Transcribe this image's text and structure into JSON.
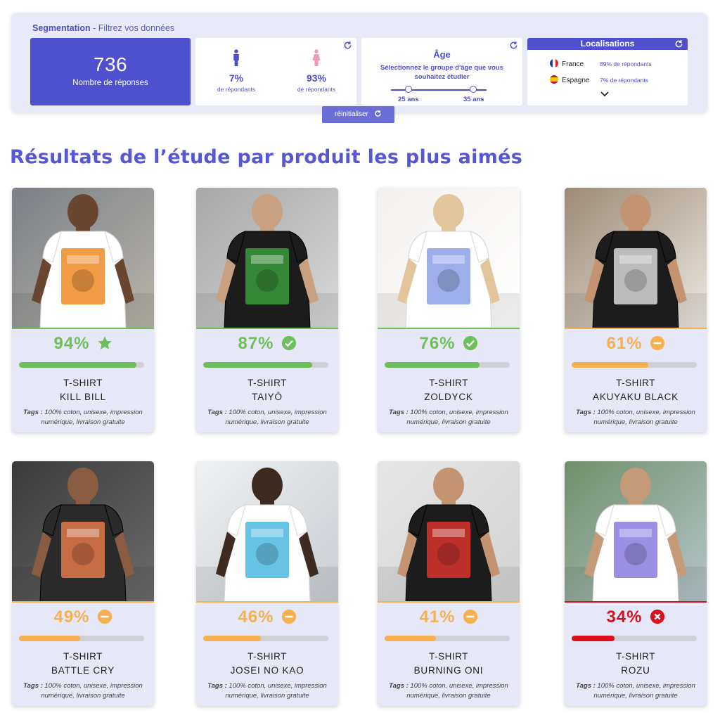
{
  "segmentation": {
    "title": "Segmentation",
    "subtitle": " - Filtrez vos données",
    "responses": {
      "count": "736",
      "label": "Nombre de réponses"
    },
    "gender": {
      "male": {
        "pct": "7%",
        "sub": "de répondants",
        "color": "#4f50cf"
      },
      "female": {
        "pct": "93%",
        "sub": "de répondants",
        "color": "#f29bb4"
      }
    },
    "age": {
      "title": "Âge",
      "description": "Sélectionnez le groupe d'âge que vous souhaitez étudier",
      "min_label": "25 ans",
      "max_label": "35 ans"
    },
    "locations": {
      "title": "Localisations",
      "items": [
        {
          "country": "France",
          "stat": "89% de répondants"
        },
        {
          "country": "Espagne",
          "stat": "7% de répondants"
        }
      ]
    },
    "reset_label": "réinitialiser"
  },
  "page_title": "Résultats de l’étude par produit les plus aimés",
  "colors": {
    "accent": "#4f50cf",
    "green": "#6ebf5a",
    "orange": "#f7b04f",
    "red": "#d9101c"
  },
  "tags_label": "Tags :",
  "tags_text": " 100% coton, unisexe,  impression numérique, livraison gratuite",
  "products": [
    {
      "score": "94%",
      "fraction": 0.94,
      "status": "star-icon",
      "type": "T-SHIRT",
      "name": "KILL BILL"
    },
    {
      "score": "87%",
      "fraction": 0.87,
      "status": "check-icon",
      "type": "T-SHIRT",
      "name": "TAIYŌ"
    },
    {
      "score": "76%",
      "fraction": 0.76,
      "status": "check-icon",
      "type": "T-SHIRT",
      "name": "ZOLDYCK"
    },
    {
      "score": "61%",
      "fraction": 0.61,
      "status": "minus-icon",
      "type": "T-SHIRT",
      "name": "AKUYAKU BLACK"
    },
    {
      "score": "49%",
      "fraction": 0.49,
      "status": "minus-icon",
      "type": "T-SHIRT",
      "name": "BATTLE CRY"
    },
    {
      "score": "46%",
      "fraction": 0.46,
      "status": "minus-icon",
      "type": "T-SHIRT",
      "name": "JOSEI NO KAO"
    },
    {
      "score": "41%",
      "fraction": 0.41,
      "status": "minus-icon",
      "type": "T-SHIRT",
      "name": "BURNING ONI"
    },
    {
      "score": "34%",
      "fraction": 0.34,
      "status": "cross-icon",
      "type": "T-SHIRT",
      "name": "ROZU"
    }
  ]
}
